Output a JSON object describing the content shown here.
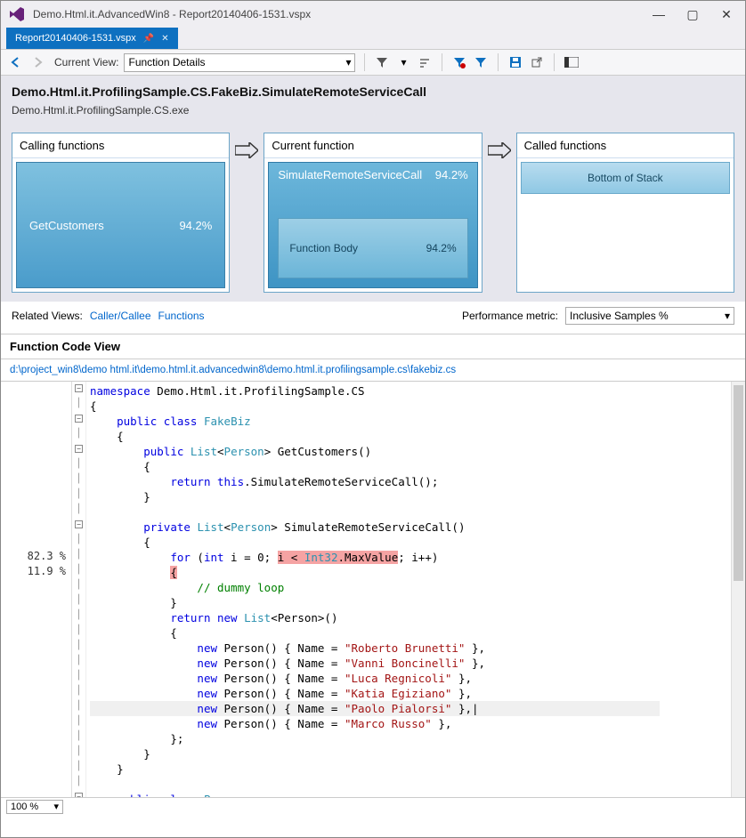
{
  "window": {
    "title": "Demo.Html.it.AdvancedWin8 - Report20140406-1531.vspx"
  },
  "tab": {
    "label": "Report20140406-1531.vspx"
  },
  "toolbar": {
    "current_view_label": "Current View:",
    "current_view_value": "Function Details"
  },
  "header": {
    "function": "Demo.Html.it.ProfilingSample.CS.FakeBiz.SimulateRemoteServiceCall",
    "module": "Demo.Html.it.ProfilingSample.CS.exe"
  },
  "panels": {
    "calling_title": "Calling functions",
    "current_title": "Current function",
    "called_title": "Called functions",
    "calling_name": "GetCustomers",
    "calling_pct": "94.2%",
    "current_name": "SimulateRemoteServiceCall",
    "current_pct": "94.2%",
    "body_label": "Function Body",
    "body_pct": "94.2%",
    "bottom_label": "Bottom of Stack"
  },
  "related": {
    "label": "Related Views:",
    "link1": "Caller/Callee",
    "link2": "Functions",
    "metric_label": "Performance metric:",
    "metric_value": "Inclusive Samples %"
  },
  "codeview": {
    "title": "Function Code View",
    "path": "d:\\project_win8\\demo html.it\\demo.html.it.advancedwin8\\demo.html.it.profilingsample.cs\\fakebiz.cs"
  },
  "pct": {
    "l1": "82.3 %",
    "l2": "11.9 %"
  },
  "zoom": {
    "value": "100 %"
  },
  "code": {
    "ns": "namespace",
    "nsName": " Demo.Html.it.ProfilingSample.CS",
    "pub": "public",
    "cls": "class",
    "fakebiz": "FakeBiz",
    "list": "List",
    "person": "Person",
    "getcust": " GetCustomers()",
    "ret": "return",
    "this": "this",
    "call": ".SimulateRemoteServiceCall();",
    "priv": "private",
    "sim": " SimulateRemoteServiceCall()",
    "for": "for",
    "int": "int",
    "forInit": " i = 0; ",
    "cond": "i < ",
    "int32": "Int32",
    "maxv": ".MaxValue",
    "forTail": "; i++)",
    "dummy": "// dummy loop",
    "new": "new",
    "newlist": "<Person>()",
    "np": " Person() { Name = ",
    "n1": "\"Roberto Brunetti\"",
    "n2": "\"Vanni Boncinelli\"",
    "n3": "\"Luca Regnicoli\"",
    "n4": "\"Katia Egiziano\"",
    "n5": "\"Paolo Pialorsi\"",
    "n6": "\"Marco Russo\"",
    "tail": " },",
    "tailCursor": " },|",
    "endarr": "};"
  }
}
